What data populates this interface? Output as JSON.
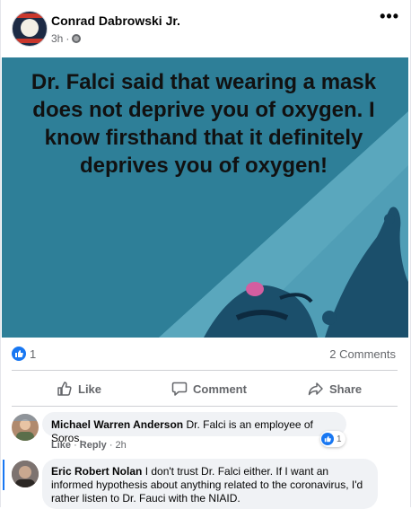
{
  "post": {
    "author": "Conrad Dabrowski Jr.",
    "time": "3h",
    "separator": "·",
    "more_label": "•••",
    "image_text": "Dr. Falci said that wearing a mask does not deprive you of oxygen. I know firsthand that it definitely deprives you of oxygen!",
    "reaction_count": "1",
    "comments_count": "2 Comments"
  },
  "actions": {
    "like": "Like",
    "comment": "Comment",
    "share": "Share"
  },
  "comments": [
    {
      "author": "Michael Warren Anderson",
      "text": "Dr. Falci is an employee of Soros.",
      "like": "Like",
      "reply": "Reply",
      "time": "2h",
      "reactions": "1"
    },
    {
      "author": "Eric Robert Nolan",
      "text": "I don't trust Dr. Falci either. If I want an informed hypothesis about anything related to the coronavirus, I'd rather listen to Dr. Fauci with the NIAID."
    }
  ],
  "colors": {
    "facebook_blue": "#1877f2",
    "image_background": "#2f7d96",
    "bubble_bg": "#f0f2f5"
  },
  "icons": [
    "globe-icon",
    "more-icon",
    "like-reaction-icon",
    "thumbs-up-icon",
    "comment-icon",
    "share-icon"
  ]
}
